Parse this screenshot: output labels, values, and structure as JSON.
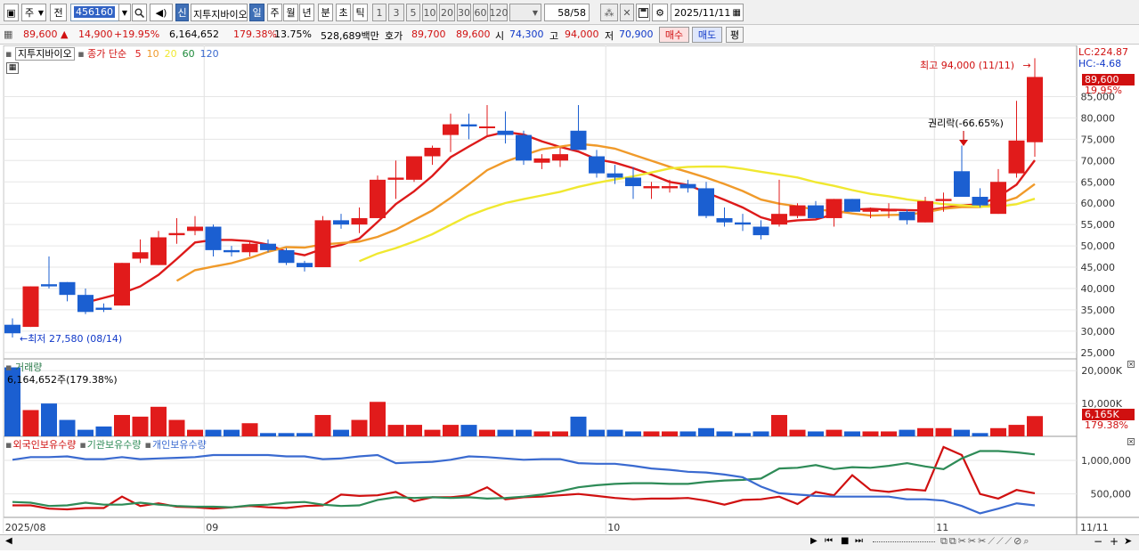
{
  "toolbar": {
    "period_main": "주",
    "period_prefix": "전",
    "code": "456160",
    "new_badge": "신",
    "stock_name": "지투지바이오",
    "periods": [
      "일",
      "주",
      "월",
      "년",
      "분",
      "초",
      "틱"
    ],
    "active_period": "일",
    "intervals": [
      "1",
      "3",
      "5",
      "10",
      "20",
      "30",
      "60",
      "120"
    ],
    "count": "58/58",
    "date": "2025/11/11"
  },
  "quote": {
    "price": "89,600",
    "change_arrow": "▲",
    "change": "14,900",
    "change_pct": "+19.95%",
    "volume": "6,164,652",
    "volume_ratio": "179.38%",
    "turnover": "13.75%",
    "amount": "528,689백만",
    "bid_label": "호가",
    "ask_price": "89,700",
    "bid_price": "89,600",
    "open_label": "시",
    "open": "74,300",
    "high_label": "고",
    "high": "94,000",
    "low_label": "저",
    "low": "70,900",
    "buy_button": "매수",
    "sell_button": "매도",
    "eval_button": "평"
  },
  "price_panel": {
    "legend_name": "지투지바이오",
    "legend_series": "종가 단순",
    "ma_labels": [
      {
        "label": "5",
        "color": "#dd1a1a"
      },
      {
        "label": "10",
        "color": "#f09a2a"
      },
      {
        "label": "20",
        "color": "#f0e830"
      },
      {
        "label": "60",
        "color": "#1e8a3a"
      },
      {
        "label": "120",
        "color": "#3a6ad0"
      }
    ],
    "lc_label": "LC:224.87",
    "hc_label": "HC:-4.68",
    "high_note": "최고 94,000 (11/11)",
    "low_note": "최저 27,580 (08/14)",
    "rights_note": "권리락(-66.65%)",
    "last_price_tag": "89,600",
    "last_pct_tag": "19.95%"
  },
  "volume_panel": {
    "title": "거래량",
    "value_note": "6,164,652주(179.38%)",
    "last_tag": "6,165K",
    "last_pct_tag": "179.38%"
  },
  "holdings_panel": {
    "legends": [
      {
        "label": "외국인보유수량",
        "color": "#d01010"
      },
      {
        "label": "기관보유수량",
        "color": "#2e8b57"
      },
      {
        "label": "개인보유수량",
        "color": "#3a6ad0"
      }
    ]
  },
  "x_axis": {
    "labels": [
      {
        "text": "2025/08",
        "index": 0
      },
      {
        "text": "09",
        "index": 11
      },
      {
        "text": "10",
        "index": 33
      },
      {
        "text": "11",
        "index": 51
      }
    ],
    "last_label": "11/11"
  },
  "chart_data": {
    "type": "candlestick",
    "price_axis": {
      "ticks": [
        25000,
        30000,
        35000,
        40000,
        45000,
        50000,
        55000,
        60000,
        65000,
        70000,
        75000,
        80000,
        85000
      ],
      "ylim": [
        23500,
        97000
      ]
    },
    "candles": [
      [
        31500,
        33000,
        28500,
        29500
      ],
      [
        31000,
        40500,
        31000,
        40500
      ],
      [
        41000,
        47500,
        40000,
        40500
      ],
      [
        41500,
        41500,
        37000,
        38500
      ],
      [
        38500,
        40000,
        34000,
        34500
      ],
      [
        35500,
        36500,
        34500,
        35000
      ],
      [
        36000,
        46000,
        36000,
        46000
      ],
      [
        47000,
        51500,
        46000,
        48500
      ],
      [
        45500,
        53500,
        45500,
        52000
      ],
      [
        52500,
        56500,
        50500,
        53000
      ],
      [
        53500,
        57000,
        52500,
        54500
      ],
      [
        54500,
        55000,
        47500,
        49000
      ],
      [
        49000,
        50000,
        47500,
        48500
      ],
      [
        48500,
        51000,
        47500,
        50500
      ],
      [
        50500,
        51500,
        48500,
        49000
      ],
      [
        49000,
        49500,
        45500,
        46000
      ],
      [
        46000,
        46500,
        44000,
        45000
      ],
      [
        45000,
        57000,
        45000,
        56000
      ],
      [
        56000,
        57500,
        54000,
        55000
      ],
      [
        55000,
        59000,
        53000,
        56500
      ],
      [
        56500,
        66500,
        56500,
        65500
      ],
      [
        65500,
        70000,
        61000,
        66000
      ],
      [
        65500,
        70500,
        65000,
        71000
      ],
      [
        71000,
        73500,
        69000,
        73000
      ],
      [
        76000,
        81000,
        72000,
        78500
      ],
      [
        78500,
        81000,
        75000,
        78000
      ],
      [
        78000,
        83000,
        75500,
        78000
      ],
      [
        77000,
        81500,
        74000,
        76000
      ],
      [
        76000,
        77000,
        69000,
        70000
      ],
      [
        69500,
        71500,
        68000,
        70500
      ],
      [
        70000,
        73000,
        68500,
        71500
      ],
      [
        77000,
        83000,
        72500,
        72500
      ],
      [
        71000,
        72500,
        66000,
        67000
      ],
      [
        67000,
        69000,
        64500,
        66000
      ],
      [
        66000,
        68500,
        61000,
        64000
      ],
      [
        63500,
        65000,
        61000,
        64000
      ],
      [
        63500,
        65500,
        62500,
        64000
      ],
      [
        64500,
        65500,
        62500,
        63500
      ],
      [
        63500,
        65000,
        56500,
        57000
      ],
      [
        56500,
        59000,
        54500,
        55500
      ],
      [
        55500,
        57500,
        53500,
        55000
      ],
      [
        54500,
        56000,
        51500,
        52500
      ],
      [
        55000,
        65500,
        54500,
        57500
      ],
      [
        57000,
        60000,
        56500,
        59500
      ],
      [
        59500,
        60500,
        56500,
        56500
      ],
      [
        56500,
        61000,
        54500,
        61000
      ],
      [
        61000,
        61000,
        58000,
        58000
      ],
      [
        58000,
        59000,
        56500,
        58500
      ],
      [
        58500,
        60000,
        56500,
        58500
      ],
      [
        58000,
        58500,
        55000,
        56000
      ],
      [
        55500,
        61500,
        55500,
        60500
      ],
      [
        60500,
        62500,
        58000,
        61000
      ],
      [
        67500,
        73500,
        61500,
        61500
      ],
      [
        61500,
        63500,
        59000,
        59500
      ],
      [
        57500,
        68000,
        57500,
        65000
      ],
      [
        67000,
        84000,
        66000,
        74700
      ],
      [
        74300,
        94000,
        70900,
        89600
      ]
    ],
    "volume": {
      "ticks": [
        10000,
        20000
      ],
      "unit": "K",
      "values": [
        21000,
        8000,
        10000,
        5000,
        2000,
        3000,
        6500,
        6000,
        9000,
        5000,
        2000,
        2000,
        2000,
        4000,
        1000,
        1000,
        1000,
        6500,
        2000,
        5000,
        10500,
        3500,
        3500,
        2000,
        3500,
        3500,
        2000,
        2000,
        2000,
        1500,
        1500,
        6000,
        2000,
        2000,
        1500,
        1500,
        1500,
        1500,
        2500,
        1500,
        1000,
        1500,
        6500,
        2000,
        1500,
        2000,
        1500,
        1500,
        1500,
        2000,
        2500,
        2500,
        2000,
        1000,
        2500,
        3500,
        6165
      ]
    },
    "holdings": {
      "ticks": [
        500000,
        1000000
      ],
      "series": [
        {
          "name": "외국인보유수량",
          "values": [
            330000,
            330000,
            280000,
            270000,
            290000,
            290000,
            460000,
            320000,
            360000,
            310000,
            300000,
            280000,
            300000,
            320000,
            300000,
            290000,
            320000,
            330000,
            490000,
            470000,
            480000,
            530000,
            390000,
            450000,
            450000,
            480000,
            600000,
            420000,
            450000,
            460000,
            480000,
            500000,
            470000,
            440000,
            420000,
            430000,
            430000,
            440000,
            400000,
            340000,
            410000,
            420000,
            460000,
            350000,
            530000,
            480000,
            780000,
            560000,
            530000,
            570000,
            550000,
            1200000,
            1080000,
            500000,
            430000,
            560000,
            510000,
            520000
          ]
        },
        {
          "name": "기관보유수량",
          "values": [
            380000,
            370000,
            320000,
            330000,
            370000,
            340000,
            340000,
            370000,
            340000,
            320000,
            310000,
            310000,
            300000,
            330000,
            340000,
            370000,
            380000,
            340000,
            320000,
            330000,
            410000,
            450000,
            440000,
            450000,
            440000,
            450000,
            430000,
            440000,
            460000,
            490000,
            540000,
            600000,
            630000,
            650000,
            660000,
            660000,
            650000,
            650000,
            680000,
            700000,
            710000,
            730000,
            880000,
            890000,
            930000,
            870000,
            900000,
            890000,
            920000,
            960000,
            910000,
            870000,
            1030000,
            1140000,
            1140000,
            1120000,
            1090000,
            1110000
          ]
        },
        {
          "name": "개인보유수량",
          "values": [
            1010000,
            1050000,
            1050000,
            1060000,
            1020000,
            1020000,
            1050000,
            1020000,
            1030000,
            1040000,
            1050000,
            1080000,
            1080000,
            1080000,
            1080000,
            1060000,
            1060000,
            1020000,
            1030000,
            1060000,
            1080000,
            960000,
            970000,
            980000,
            1010000,
            1060000,
            1050000,
            1030000,
            1010000,
            1020000,
            1020000,
            960000,
            950000,
            950000,
            920000,
            880000,
            860000,
            830000,
            820000,
            790000,
            750000,
            610000,
            510000,
            490000,
            470000,
            460000,
            460000,
            460000,
            460000,
            420000,
            420000,
            400000,
            320000,
            210000,
            280000,
            360000,
            330000,
            400000
          ]
        }
      ]
    }
  }
}
